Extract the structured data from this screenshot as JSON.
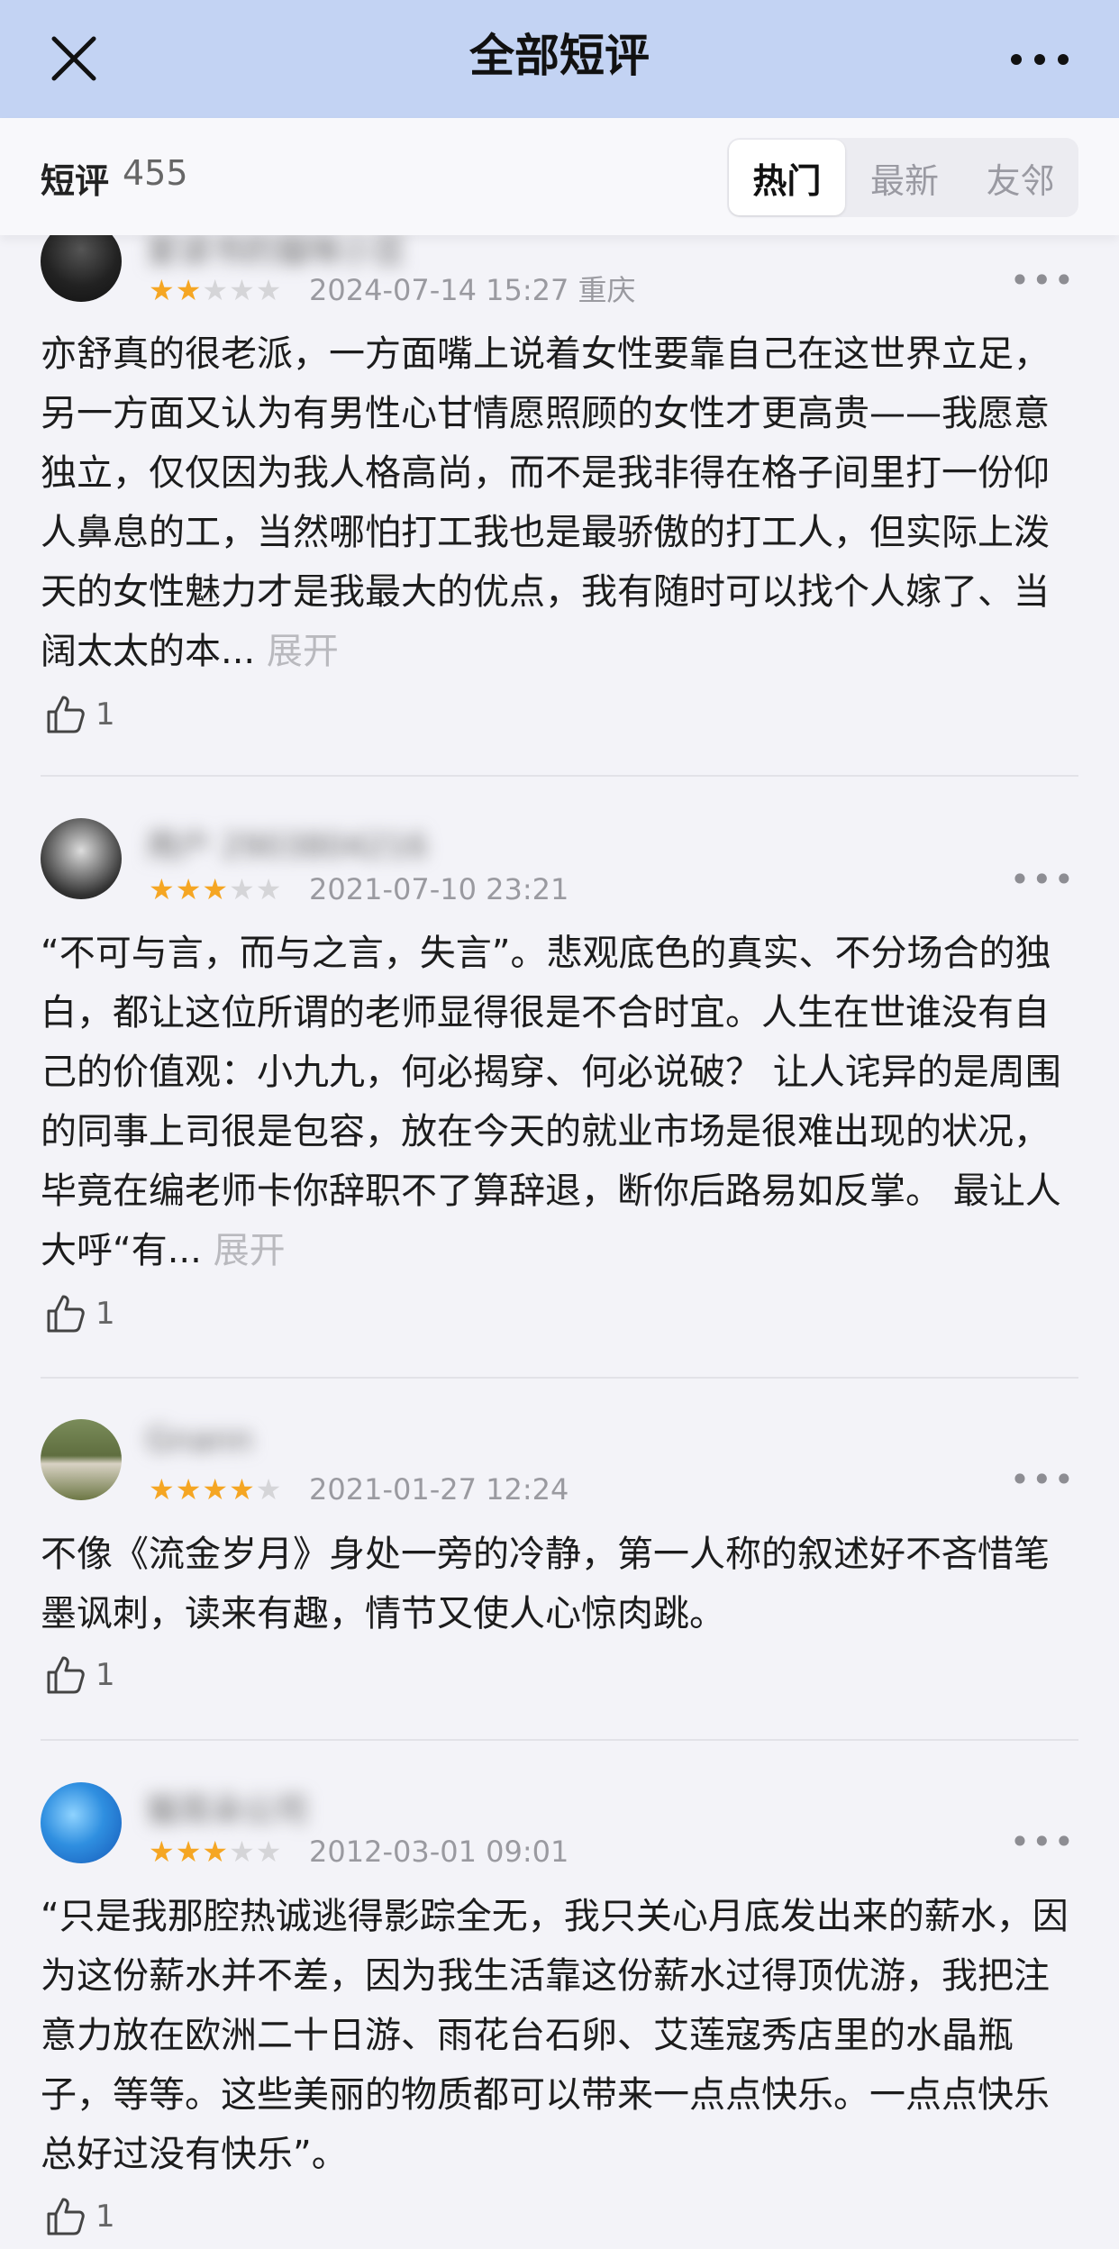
{
  "header": {
    "title": "全部短评",
    "close_icon": "close-icon",
    "more_icon": "more-icon"
  },
  "subheader": {
    "label": "短评",
    "count": "455",
    "tabs": [
      "热门",
      "最新",
      "友邻"
    ],
    "active_tab": "热门"
  },
  "reviews": [
    {
      "username": "爱读书的猫咪小豆",
      "rating": 2,
      "date": "2024-07-14 15:27",
      "location": "重庆",
      "text": "亦舒真的很老派，一方面嘴上说着女性要靠自己在这世界立足，另一方面又认为有男性心甘情愿照顾的女性才更高贵——我愿意独立，仅仅因为我人格高尚，而不是我非得在格子间里打一份仰人鼻息的工，当然哪怕打工我也是最骄傲的打工人，但实际上泼天的女性魅力才是我最大的优点，我有随时可以找个人嫁了、当阔太太的本...",
      "expand": "展开",
      "likes": "1"
    },
    {
      "username": "用户 2903804216",
      "rating": 3,
      "date": "2021-07-10 23:21",
      "location": "",
      "text": "“不可与言，而与之言，失言”。悲观底色的真实、不分场合的独白，都让这位所谓的老师显得很是不合时宜。人生在世谁没有自己的价值观：小九九，何必揭穿、何必说破？  让人诧异的是周围的同事上司很是包容，放在今天的就业市场是很难出现的状况，毕竟在编老师卡你辞职不了算辞退，断你后路易如反掌。  最让人大呼“有...",
      "expand": "展开",
      "likes": "1"
    },
    {
      "username": "Gnann",
      "rating": 4,
      "date": "2021-01-27 12:24",
      "location": "",
      "text": "不像《流金岁月》身处一旁的冷静，第一人称的叙述好不吝惜笔墨讽刺，读来有趣，情节又使人心惊肉跳。",
      "expand": "",
      "likes": "1"
    },
    {
      "username": "猫耳朵公司",
      "rating": 3,
      "date": "2012-03-01 09:01",
      "location": "",
      "text": "“只是我那腔热诚逃得影踪全无，我只关心月底发出来的薪水，因为这份薪水并不差，因为我生活靠这份薪水过得顶优游，我把注意力放在欧洲二十日游、雨花台石卵、艾莲寇秀店里的水晶瓶子，等等。这些美丽的物质都可以带来一点点快乐。一点点快乐总好过没有快乐”。",
      "expand": "",
      "likes": "1"
    }
  ],
  "icons": {
    "like": "thumbs-up-icon",
    "menu": "more-dots-icon",
    "star": "star-icon"
  },
  "colors": {
    "header_bg": "#c3d3f3",
    "star_on": "#f5a623",
    "star_off": "#d5d5d8",
    "expand": "#b9b9be"
  }
}
